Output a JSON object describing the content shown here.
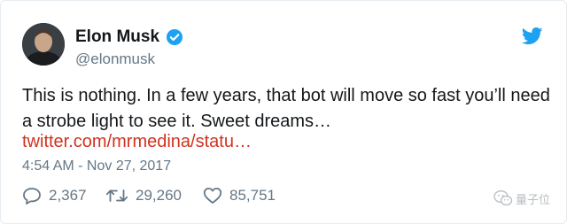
{
  "author": {
    "name": "Elon Musk",
    "handle": "@elonmusk",
    "verified": true
  },
  "tweet": {
    "text_lines": [
      "This is nothing. In a few years, that bot will move so fast you’ll need",
      "a strobe light to see it. Sweet dreams…"
    ],
    "link": "twitter.com/mrmedina/statu…",
    "timestamp": "4:54 AM - Nov 27, 2017"
  },
  "actions": {
    "replies": "2,367",
    "retweets": "29,260",
    "likes": "85,751"
  },
  "watermark": {
    "text": "量子位"
  },
  "colors": {
    "verified": "#1da1f2",
    "twitter_bird": "#1da1f2",
    "link": "#d0331f",
    "secondary_text": "#657786"
  },
  "icons": [
    "verified-badge-icon",
    "twitter-bird-icon",
    "reply-icon",
    "retweet-icon",
    "like-icon",
    "wechat-icon"
  ]
}
